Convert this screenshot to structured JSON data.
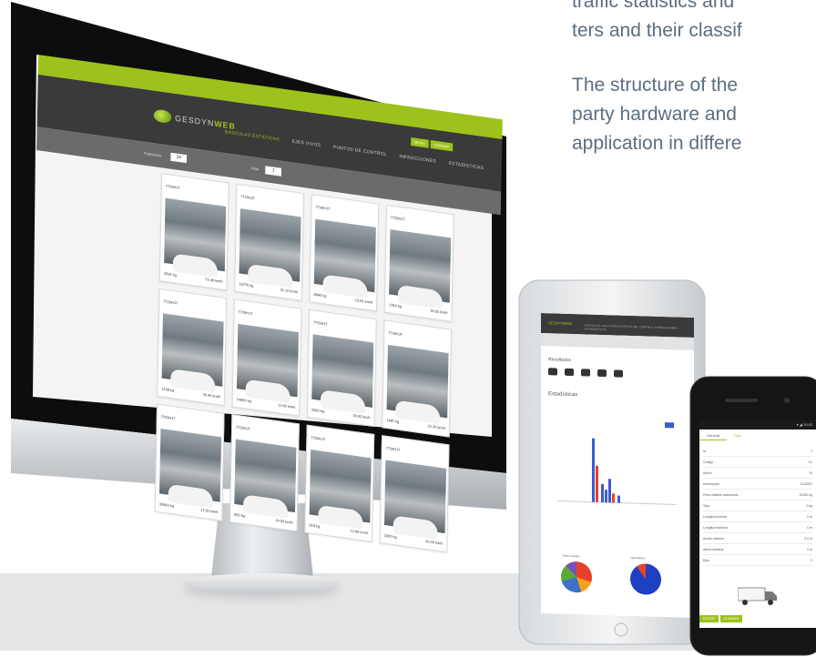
{
  "intro_text": {
    "line1": "traffic statistics and",
    "line2": "ters and their classif",
    "line3": "The structure of the",
    "line4": "party hardware and",
    "line5": "application in differe"
  },
  "colors": {
    "brand_green": "#9dc21b",
    "header_dark": "#3a3a3a",
    "floor": "#e4e5e7",
    "text": "#5d6d7e"
  },
  "desktop_app": {
    "logo": {
      "part1": "GESDYN",
      "part2": "WEB"
    },
    "nav": [
      "BÁSCULAS ESTÁTICAS",
      "EJES VIVOS",
      "PUNTOS DE CONTROL",
      "INFRACCIONES",
      "ESTADÍSTICAS"
    ],
    "user_tools": [
      "MENU",
      "CERRAR"
    ],
    "filters": {
      "pagination_label": "Paginación",
      "pagination_value": "16",
      "view_label": "Vista",
      "view_value": "1"
    },
    "records": [
      {
        "plate": "7729HJT",
        "weight": "3334 kg",
        "speed": "73.48 km/h"
      },
      {
        "plate": "7729HJT",
        "weight": "12070 kg",
        "speed": "31.10 km/h"
      },
      {
        "plate": "7729HJT",
        "weight": "6840 kg",
        "speed": "15.81 km/h"
      },
      {
        "plate": "7729HJT",
        "weight": "1769 kg",
        "speed": "19.83 km/h"
      },
      {
        "plate": "7729HJT",
        "weight": "1238 kg",
        "speed": "29.40 km/h"
      },
      {
        "plate": "7729HJT",
        "weight": "14650 kg",
        "speed": "11.50 km/h"
      },
      {
        "plate": "7729HJT",
        "weight": "2090 kg",
        "speed": "18.92 km/h"
      },
      {
        "plate": "7729HJT",
        "weight": "1687 kg",
        "speed": "22.20 km/h"
      },
      {
        "plate": "7729HJT",
        "weight": "32649 kg",
        "speed": "17.82 km/h"
      },
      {
        "plate": "7729HJT",
        "weight": "900 kg",
        "speed": "24.00 km/h"
      },
      {
        "plate": "7729HJT",
        "weight": "918 kg",
        "speed": "12.85 km/h"
      },
      {
        "plate": "7729HJT",
        "weight": "1600 kg",
        "speed": "20.68 km/h"
      }
    ]
  },
  "tablet_app": {
    "logo": "GESDYNWEB",
    "nav": "BÁSCULAS   EJES VIVOS   PUNTOS DE CONTROL   INFRACCIONES   ESTADÍSTICAS",
    "section1": "Resultados",
    "section2": "Estadísticas",
    "pie1_label": "Pesos medios",
    "pie2_label": "Velocidades"
  },
  "phone_app": {
    "status": "▾ ◢ 10:42",
    "tabs": [
      "General",
      "Ejes"
    ],
    "rows": [
      {
        "label": "Id",
        "value": "1"
      },
      {
        "label": "Código",
        "value": "C1"
      },
      {
        "label": "Activo",
        "value": "Sí"
      },
      {
        "label": "Descripción",
        "value": "CLASE1"
      },
      {
        "label": "Peso máximo autorizado",
        "value": "21000 kg"
      },
      {
        "label": "Tara",
        "value": "0 kg"
      },
      {
        "label": "Longitud mínima",
        "value": "0 m"
      },
      {
        "label": "Longitud máxima",
        "value": "0 m"
      },
      {
        "label": "Ancho máximo",
        "value": "0.0 m"
      },
      {
        "label": "Altura máxima",
        "value": "0 m"
      },
      {
        "label": "Ejes",
        "value": "2"
      }
    ],
    "buttons": [
      "EDITAR",
      "ELIMINAR"
    ]
  }
}
